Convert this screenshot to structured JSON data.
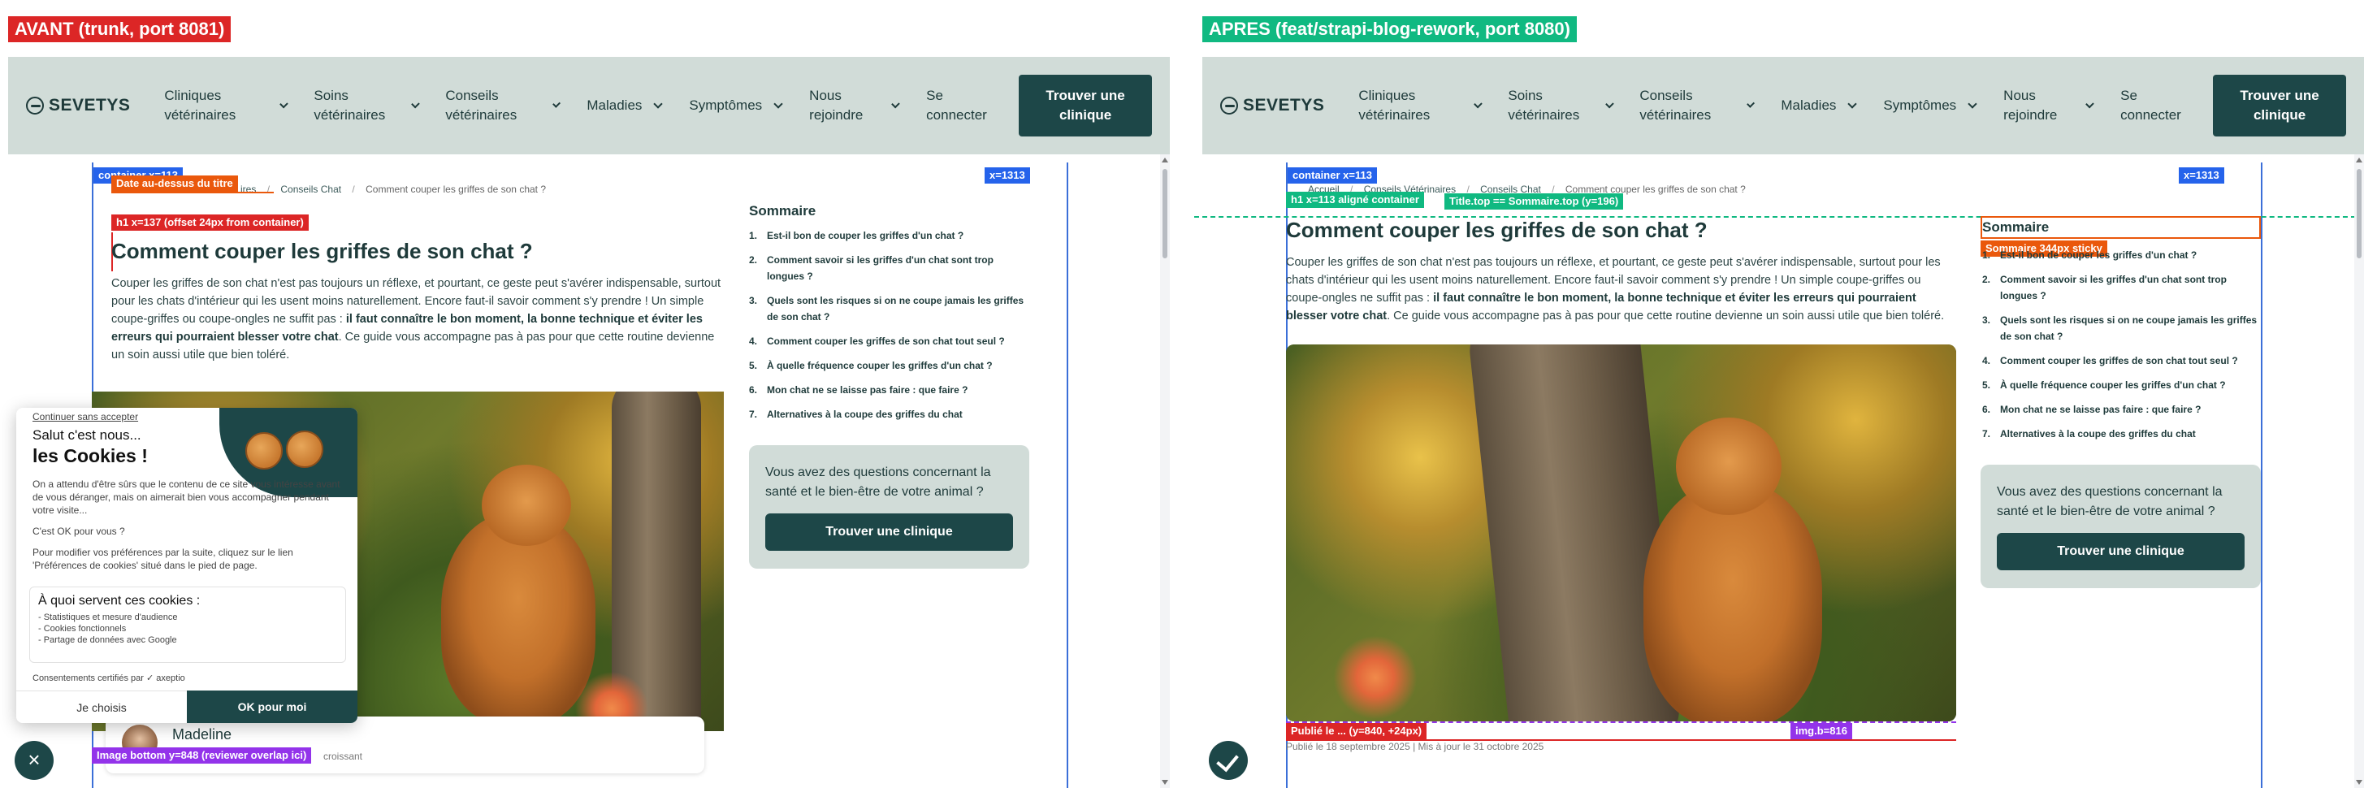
{
  "panels": {
    "left_label": "AVANT (trunk, port 8081)",
    "right_label": "APRES (feat/strapi-blog-rework, port 8080)"
  },
  "header": {
    "logo": "SEVETYS",
    "nav": [
      {
        "label": "Cliniques vétérinaires",
        "dropdown": true
      },
      {
        "label": "Soins vétérinaires",
        "dropdown": true
      },
      {
        "label": "Conseils vétérinaires",
        "dropdown": true
      },
      {
        "label": "Maladies",
        "dropdown": true
      },
      {
        "label": "Symptômes",
        "dropdown": true
      },
      {
        "label": "Nous rejoindre",
        "dropdown": true
      },
      {
        "label": "Se connecter",
        "dropdown": false
      }
    ],
    "cta": "Trouver une clinique"
  },
  "article": {
    "breadcrumb": [
      "Accueil",
      "Conseils Vétérinaires",
      "Conseils Chat",
      "Comment couper les griffes de son chat ?"
    ],
    "breadcrumb_left_visible": [
      "ires",
      "Conseils Chat",
      "Comment couper les griffes de son chat ?"
    ],
    "title": "Comment couper les griffes de son chat ?",
    "intro_plain_1": "Couper les griffes de son chat n'est pas toujours un réflexe, et pourtant, ce geste peut s'avérer indispensable, surtout pour les chats d'intérieur qui les usent moins naturellement. Encore faut-il savoir comment s'y prendre ! Un simple coupe-griffes ou coupe-ongles ne suffit pas : ",
    "intro_bold": "il faut connaître le bon moment, la bonne technique et éviter les erreurs qui pourraient blesser votre chat",
    "intro_plain_2": ". Ce guide vous accompagne pas à pas pour que cette routine devienne un soin aussi utile que bien toléré.",
    "published": "Publié le 18 septembre 2025 | Mis à jour le 31 octobre 2025"
  },
  "author": {
    "name": "Madeline",
    "role": "croissant"
  },
  "sidebar": {
    "title": "Sommaire",
    "items": [
      "Est-il bon de couper les griffes d'un chat ?",
      "Comment savoir si les griffes d'un chat sont trop longues ?",
      "Quels sont les risques si on ne coupe jamais les griffes de son chat ?",
      "Comment couper les griffes de son chat tout seul ?",
      "À quelle fréquence couper les griffes d'un chat ?",
      "Mon chat ne se laisse pas faire : que faire ?",
      "Alternatives à la coupe des griffes du chat"
    ],
    "question": "Vous avez des questions concernant la santé et le bien-être de votre animal ?",
    "question_cta": "Trouver une clinique"
  },
  "cookie": {
    "skip": "Continuer sans accepter",
    "hi": "Salut c'est nous...",
    "big": "les Cookies !",
    "body1": "On a attendu d'être sûrs que le contenu de ce site vous intéresse avant de vous déranger, mais on aimerait bien vous accompagner pendant votre visite...",
    "body2": "C'est OK pour vous ?",
    "body3": "Pour modifier vos préférences par la suite, cliquez sur le lien 'Préférences de cookies' situé dans le pied de page.",
    "usage_title": "À quoi servent ces cookies :",
    "usage_items": [
      "- Statistiques et mesure d'audience",
      "- Cookies fonctionnels",
      "- Partage de données avec Google"
    ],
    "certified": "Consentements certifiés par ✓ axeptio",
    "btn_choose": "Je choisis",
    "btn_ok": "OK pour moi"
  },
  "annotations_left": {
    "container": "container x=113",
    "date": "Date au-dessus du titre",
    "h1": "h1 x=137 (offset 24px from container)",
    "x1313": "x=1313",
    "img_bottom": "Image bottom y=848 (reviewer overlap ici)"
  },
  "annotations_right": {
    "container": "container x=113",
    "h1": "h1 x=113 aligné container",
    "title_top": "Title.top == Sommaire.top (y=196)",
    "sticky": "Sommaire 344px sticky",
    "published_tag": "Publié le ... (y=840, +24px)",
    "img_b": "img.b=816",
    "x1313": "x=1313"
  },
  "colors": {
    "header_bg": "#d1dcd8",
    "brand_dark": "#1d4748",
    "annotation_blue": "#2563eb",
    "annotation_orange": "#ea580c",
    "annotation_red": "#dc2626",
    "annotation_green": "#10b981",
    "annotation_purple": "#9333ea"
  }
}
